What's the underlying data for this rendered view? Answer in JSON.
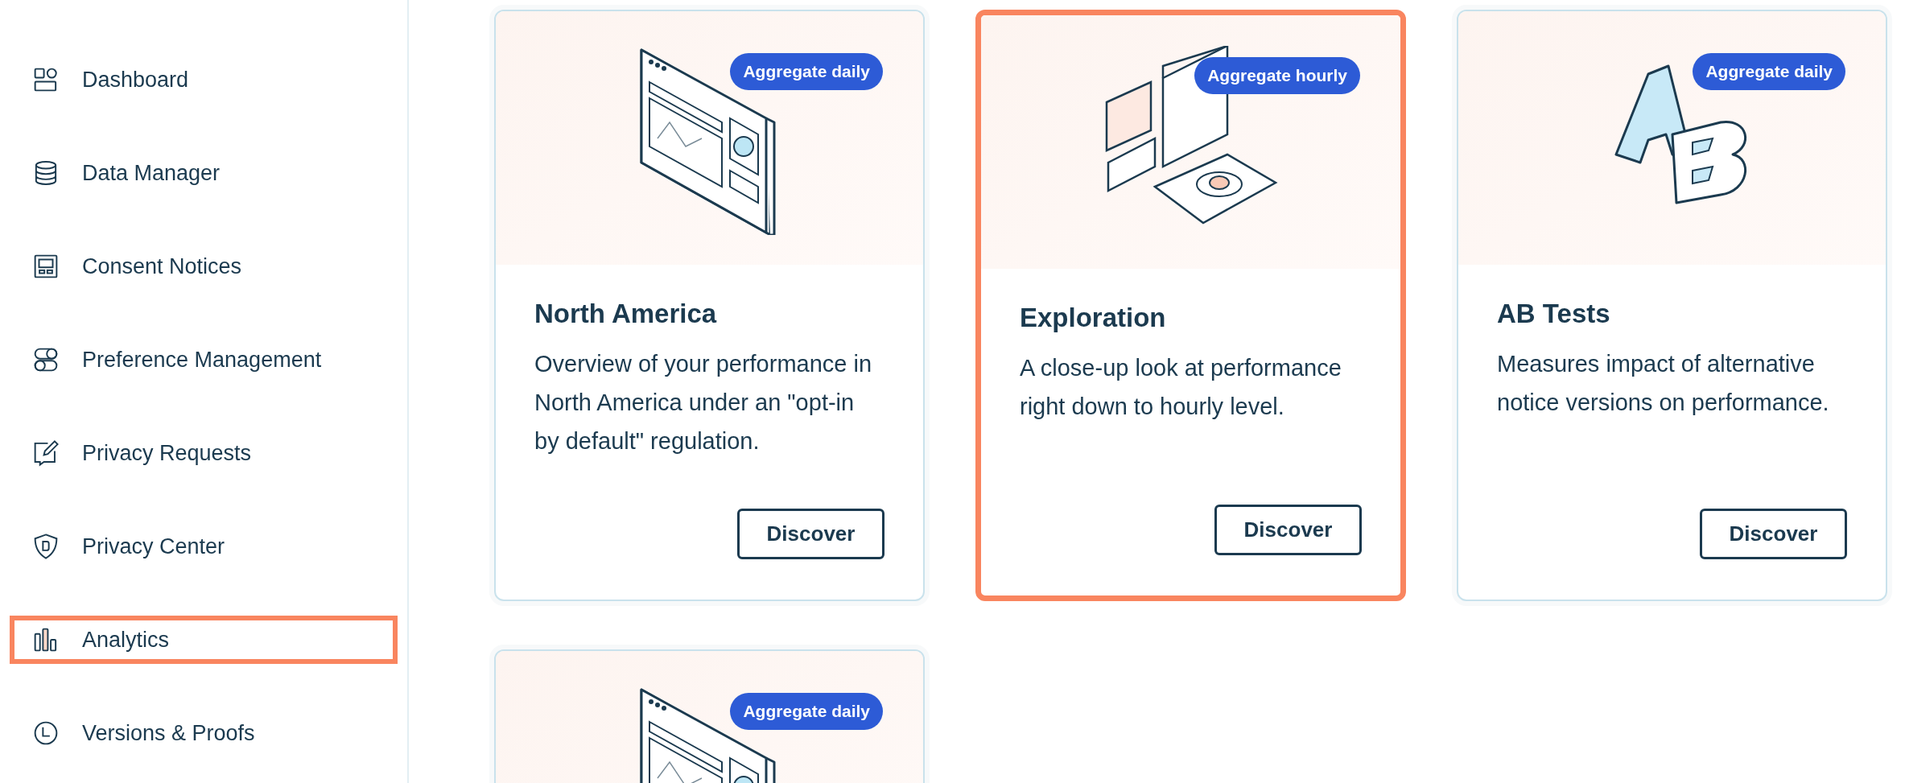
{
  "sidebar": {
    "items": [
      {
        "label": "Dashboard",
        "kind": "dashboard",
        "selected": false
      },
      {
        "label": "Data Manager",
        "kind": "database",
        "selected": false
      },
      {
        "label": "Consent Notices",
        "kind": "notice",
        "selected": false
      },
      {
        "label": "Preference Management",
        "kind": "toggles",
        "selected": false
      },
      {
        "label": "Privacy Requests",
        "kind": "edit",
        "selected": false
      },
      {
        "label": "Privacy Center",
        "kind": "shield",
        "selected": false
      },
      {
        "label": "Analytics",
        "kind": "bars",
        "selected": true
      },
      {
        "label": "Versions & Proofs",
        "kind": "clock",
        "selected": false
      }
    ]
  },
  "cards": [
    {
      "kind": "dashboard",
      "badge": "Aggregate daily",
      "title": "North America",
      "description": "Overview of your performance in North America under an \"opt-in by default\" regulation.",
      "button": "Discover",
      "highlighted": false
    },
    {
      "kind": "exploration",
      "badge": "Aggregate hourly",
      "title": "Exploration",
      "description": "A close-up look at performance right down to hourly level.",
      "button": "Discover",
      "highlighted": true
    },
    {
      "kind": "ab",
      "badge": "Aggregate daily",
      "title": "AB Tests",
      "description": "Measures impact of alternative notice versions on performance.",
      "button": "Discover",
      "highlighted": false
    },
    {
      "kind": "dashboard",
      "badge": "Aggregate daily",
      "highlighted": false
    }
  ]
}
